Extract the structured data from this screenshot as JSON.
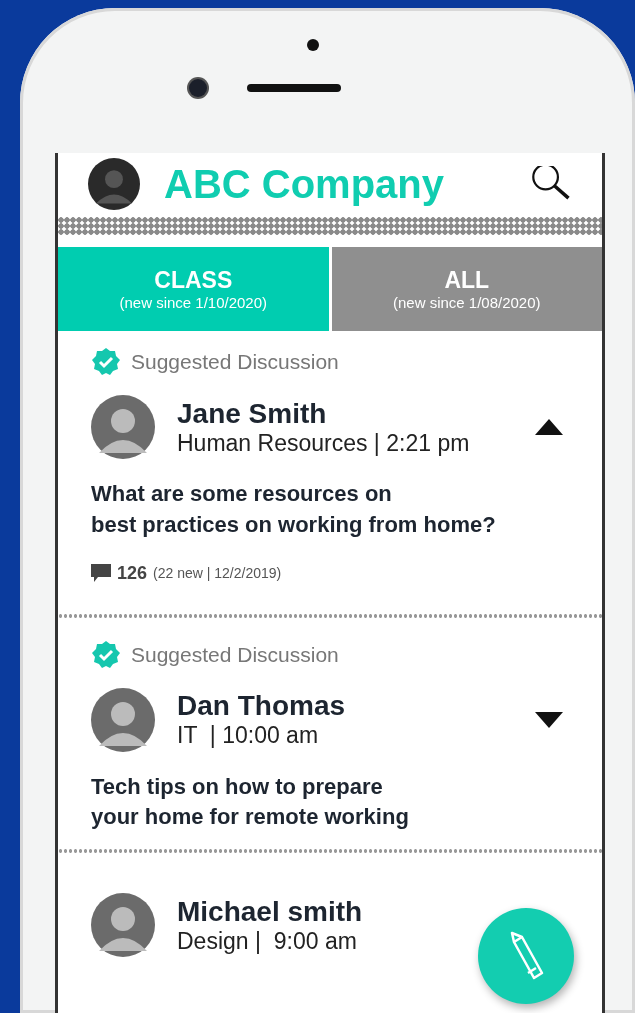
{
  "header": {
    "title": "ABC Company"
  },
  "tabs": [
    {
      "label": "CLASS",
      "subtitle": "(new since 1/10/2020)",
      "selected": true
    },
    {
      "label": "ALL",
      "subtitle": "(new since 1/08/2020)",
      "selected": false
    }
  ],
  "posts": [
    {
      "suggested": true,
      "suggestion_label": "Suggested Discussion",
      "author": "Jane Smith",
      "meta": "Human Resources | 2:21 pm",
      "expanded": true,
      "question": "What are some resources on\nbest practices on working from home?",
      "comments": {
        "count": "126",
        "detail": "(22 new | 12/2/2019)"
      }
    },
    {
      "suggested": true,
      "suggestion_label": "Suggested Discussion",
      "author": "Dan Thomas",
      "meta": "IT  | 10:00 am",
      "expanded": false,
      "question": "Tech tips on how to prepare\nyour home for remote working"
    },
    {
      "suggested": false,
      "author": "Michael smith",
      "meta": "Design |  9:00 am"
    }
  ]
}
